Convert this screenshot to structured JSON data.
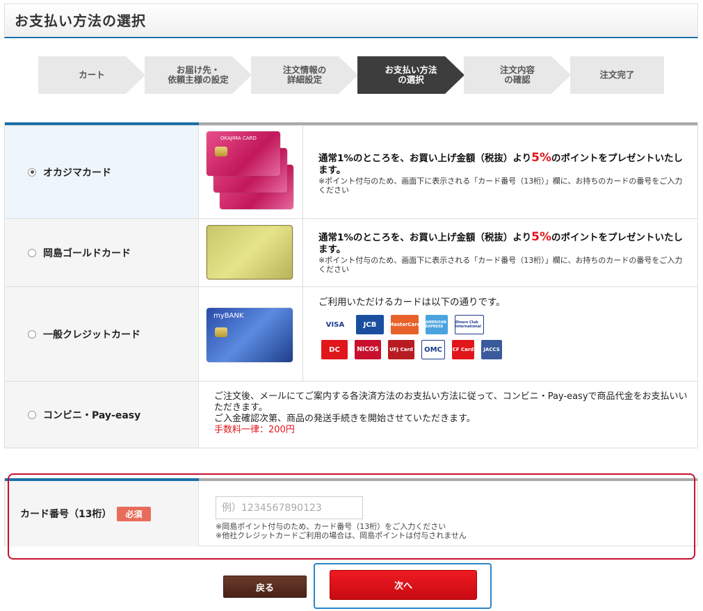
{
  "page_title": "お支払い方法の選択",
  "steps": [
    {
      "label": "カート",
      "active": false
    },
    {
      "label": "お届け先・\n依頼主様の設定",
      "active": false
    },
    {
      "label": "注文情報の\n詳細設定",
      "active": false
    },
    {
      "label": "お支払い方法\nの選択",
      "active": true
    },
    {
      "label": "注文内容\nの確認",
      "active": false
    },
    {
      "label": "注文完了",
      "active": false
    }
  ],
  "payment_methods": {
    "okajima_card": {
      "label": "オカジマカード",
      "selected": true,
      "card_name": "OKAJIMA CARD",
      "desc_pre": "通常1%のところを、お買い上げ金額（税抜）より",
      "desc_pct": "5%",
      "desc_post": "のポイントをプレゼントいたします。",
      "note": "※ポイント付与のため、画面下に表示される「カード番号（13桁）」欄に、お持ちのカードの番号をご入力ください"
    },
    "gold_card": {
      "label": "岡島ゴールドカード",
      "selected": false,
      "desc_pre": "通常1%のところを、お買い上げ金額（税抜）より",
      "desc_pct": "5%",
      "desc_post": "のポイントをプレゼントいたします。",
      "note": "※ポイント付与のため、画面下に表示される「カード番号（13桁）」欄に、お持ちのカードの番号をご入力ください"
    },
    "credit_card": {
      "label": "一般クレジットカード",
      "selected": false,
      "card_name": "myBANK",
      "desc": "ご利用いただけるカードは以下の通りです。",
      "brands": [
        "VISA",
        "JCB",
        "MasterCard",
        "AMERICAN EXPRESS",
        "Diners Club International",
        "DC",
        "NICOS",
        "UFJ Card",
        "OMC",
        "CF Card",
        "JACCS"
      ]
    },
    "convenience": {
      "label": "コンビニ・Pay-easy",
      "selected": false,
      "desc1": "ご注文後、メールにてご案内する各決済方法のお支払い方法に従って、コンビニ・Pay-easyで商品代金をお支払いいただきます。",
      "desc2": "ご入金確認次第、商品の発送手続きを開始させていただきます。",
      "fee": "手数料一律：200円"
    }
  },
  "card_number": {
    "label": "カード番号（13桁）",
    "required_badge": "必須",
    "placeholder": "例）1234567890123",
    "value": "",
    "note1": "※岡島ポイント付与のため、カード番号（13桁）をご入力ください",
    "note2": "※他社クレジットカードご利用の場合は、岡島ポイントは付与されません"
  },
  "buttons": {
    "back": "戻る",
    "next": "次へ"
  },
  "colors": {
    "accent_blue": "#1b6fa8",
    "next_red": "#e0161b",
    "back_brown": "#4a2216",
    "required": "#e86c5b"
  }
}
